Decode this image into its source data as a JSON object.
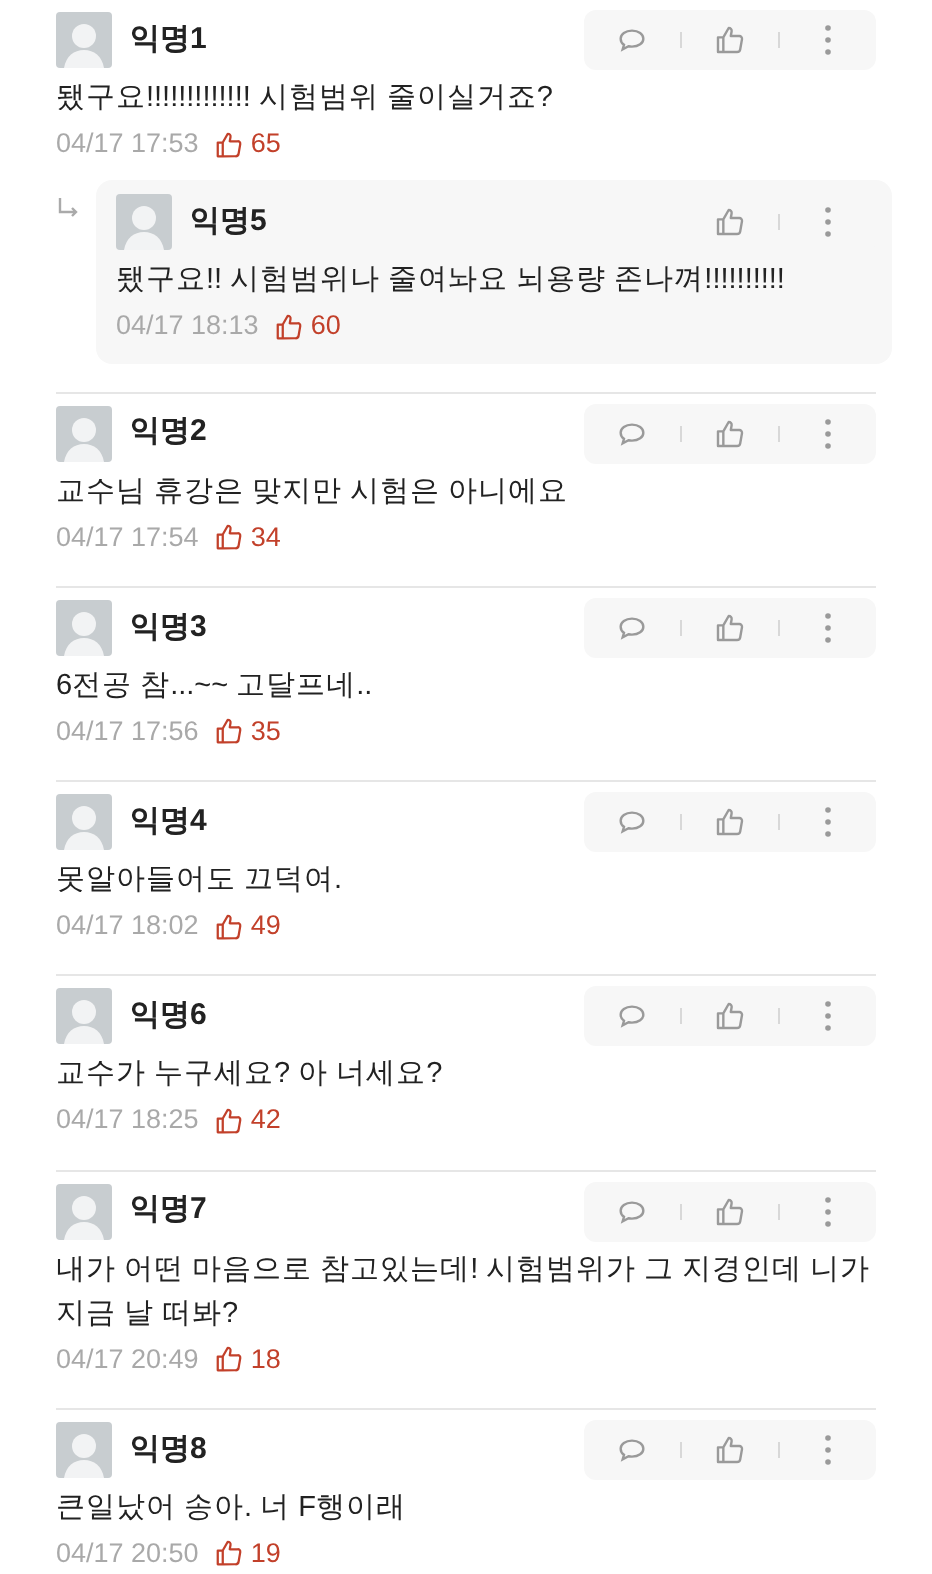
{
  "comments": [
    {
      "author": "익명1",
      "text": "됐구요!!!!!!!!!!!!! 시험범위 줄이실거죠?",
      "time": "04/17 17:53",
      "likes": "65",
      "actions": [
        {
          "kind": "comment"
        },
        {
          "kind": "like"
        },
        {
          "kind": "more"
        }
      ],
      "children": [
        {
          "author": "익명5",
          "text": "됐구요!! 시험범위나 줄여놔요 뇌용량 존나껴!!!!!!!!!!",
          "time": "04/17 18:13",
          "likes": "60",
          "actions": [
            {
              "kind": "like"
            },
            {
              "kind": "more"
            }
          ]
        }
      ]
    },
    {
      "author": "익명2",
      "text": "교수님 휴강은 맞지만 시험은 아니에요",
      "time": "04/17 17:54",
      "likes": "34",
      "actions": [
        {
          "kind": "comment"
        },
        {
          "kind": "like"
        },
        {
          "kind": "more"
        }
      ]
    },
    {
      "author": "익명3",
      "text": "6전공 참...~~ 고달프네..",
      "time": "04/17 17:56",
      "likes": "35",
      "actions": [
        {
          "kind": "comment"
        },
        {
          "kind": "like"
        },
        {
          "kind": "more"
        }
      ]
    },
    {
      "author": "익명4",
      "text": "못알아들어도 끄덕여.",
      "time": "04/17 18:02",
      "likes": "49",
      "actions": [
        {
          "kind": "comment"
        },
        {
          "kind": "like"
        },
        {
          "kind": "more"
        }
      ]
    },
    {
      "author": "익명6",
      "text": "교수가 누구세요? 아 너세요?",
      "time": "04/17 18:25",
      "likes": "42",
      "actions": [
        {
          "kind": "comment"
        },
        {
          "kind": "like"
        },
        {
          "kind": "more"
        }
      ]
    },
    {
      "author": "익명7",
      "text": "내가 어떤 마음으로 참고있는데! 시험범위가 그 지경인데 니가 지금 날 떠봐?",
      "time": "04/17 20:49",
      "likes": "18",
      "actions": [
        {
          "kind": "comment"
        },
        {
          "kind": "like"
        },
        {
          "kind": "more"
        }
      ]
    },
    {
      "author": "익명8",
      "text": "큰일났어 송아. 너 F행이래",
      "time": "04/17 20:50",
      "likes": "19",
      "actions": [
        {
          "kind": "comment"
        },
        {
          "kind": "like"
        },
        {
          "kind": "more"
        }
      ]
    }
  ]
}
